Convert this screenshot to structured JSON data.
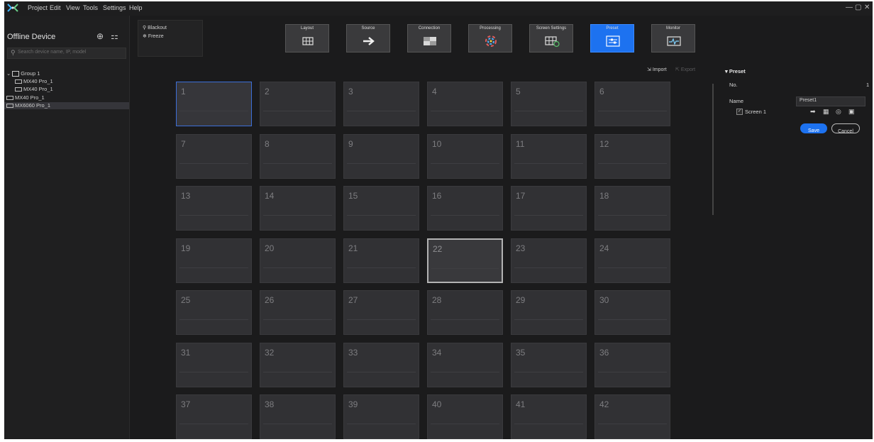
{
  "menubar": {
    "items": [
      "Project",
      "Edit",
      "View",
      "Tools",
      "Settings",
      "Help"
    ],
    "window_controls": [
      "—",
      "▢",
      "✕"
    ]
  },
  "sidebar": {
    "title": "Offline Device",
    "search_placeholder": "Search device name, IP, model",
    "group": "Group 1",
    "devices": [
      "MX40 Pro_1",
      "MX40 Pro_1",
      "MX40 Pro_1",
      "MX6060 Pro_1"
    ],
    "selected_device": "MX6060 Pro_1"
  },
  "toolpanel": {
    "blackout": "Blackout",
    "freeze": "Freeze"
  },
  "toolbar": {
    "buttons": [
      "Layout",
      "Source",
      "Connection",
      "Processing",
      "Screen Settings",
      "Preset",
      "Monitor"
    ],
    "active": "Preset"
  },
  "import_export": {
    "import": "Import",
    "export": "Export"
  },
  "grid": {
    "cells": [
      "1",
      "2",
      "3",
      "4",
      "5",
      "6",
      "7",
      "8",
      "9",
      "10",
      "11",
      "12",
      "13",
      "14",
      "15",
      "16",
      "17",
      "18",
      "19",
      "20",
      "21",
      "22",
      "23",
      "24",
      "25",
      "26",
      "27",
      "28",
      "29",
      "30",
      "31",
      "32",
      "33",
      "34",
      "35",
      "36",
      "37",
      "38",
      "39",
      "40",
      "41",
      "42"
    ],
    "selected": "22"
  },
  "preset_panel": {
    "title": "Preset",
    "no_label": "No.",
    "no_value": "1",
    "name_label": "Name",
    "name_value": "Preset1",
    "screen_label": "Screen 1",
    "save": "Save",
    "cancel": "Cancel"
  },
  "colors": {
    "accent": "#1d72f0",
    "background": "#1b1b1c",
    "cell": "#313134"
  }
}
